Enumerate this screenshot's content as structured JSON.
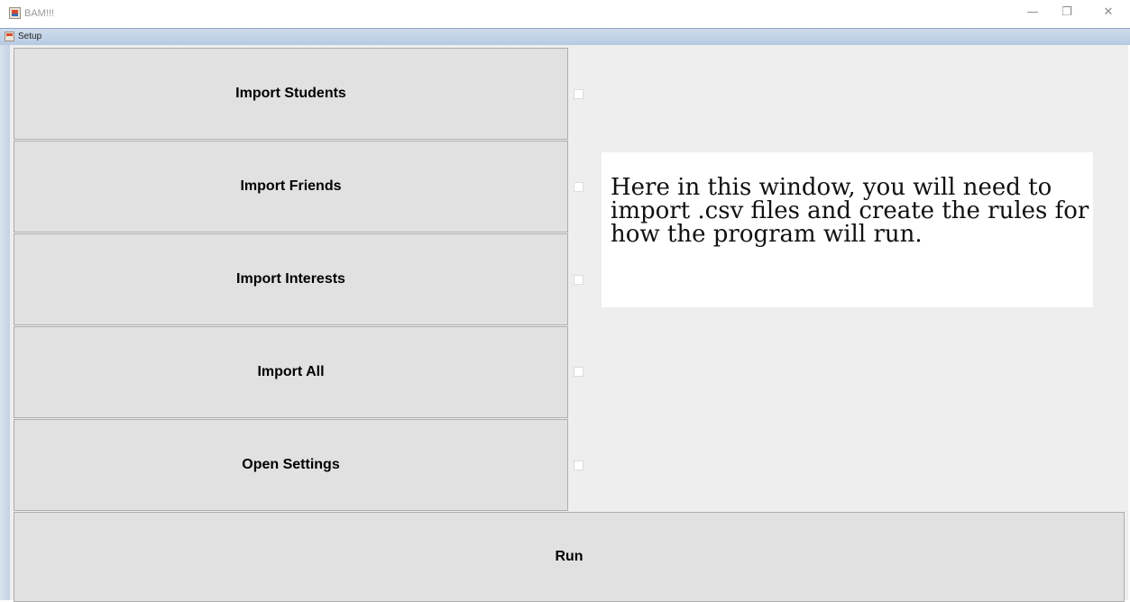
{
  "window": {
    "title": "BAM!!!",
    "controls": {
      "minimize": "—",
      "maximize": "❐",
      "close": "✕"
    }
  },
  "internal_frame": {
    "title": "Setup"
  },
  "buttons": {
    "import_students": "Import Students",
    "import_friends": "Import Friends",
    "import_interests": "Import Interests",
    "import_all": "Import All",
    "open_settings": "Open Settings",
    "run": "Run"
  },
  "checkboxes": {
    "students": false,
    "friends": false,
    "interests": false,
    "all": false,
    "settings": false
  },
  "info": {
    "text": "Here in this window, you will need to import .csv files and create the rules for how the program will run."
  }
}
